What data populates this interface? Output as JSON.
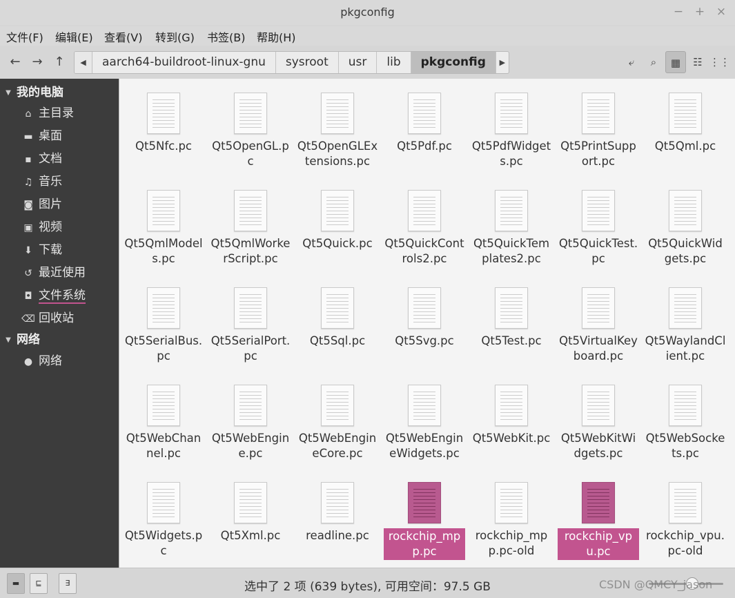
{
  "window": {
    "title": "pkgconfig",
    "minimize": "−",
    "maximize": "+",
    "close": "×"
  },
  "menu": [
    "文件(F)",
    "编辑(E)",
    "查看(V)",
    "转到(G)",
    "书签(B)",
    "帮助(H)"
  ],
  "toolbar": {
    "back_icon": "←",
    "forward_icon": "→",
    "up_icon": "↑",
    "crumb_prev": "◀",
    "crumb_next": "▶",
    "breadcrumbs": [
      "aarch64-buildroot-linux-gnu",
      "sysroot",
      "usr",
      "lib",
      "pkgconfig"
    ],
    "active_crumb": "pkgconfig",
    "location_icon": "⤶",
    "search_icon": "⌕",
    "icon_view_icon": "▦",
    "list_view_icon": "☷",
    "compact_view_icon": "⋮⋮"
  },
  "sidebar": {
    "computer_header": "我的电脑",
    "network_header": "网络",
    "items": [
      {
        "icon": "⌂",
        "label": "主目录"
      },
      {
        "icon": "▬",
        "label": "桌面"
      },
      {
        "icon": "▪",
        "label": "文档"
      },
      {
        "icon": "♫",
        "label": "音乐"
      },
      {
        "icon": "◙",
        "label": "图片"
      },
      {
        "icon": "▣",
        "label": "视频"
      },
      {
        "icon": "⬇",
        "label": "下载"
      },
      {
        "icon": "↺",
        "label": "最近使用"
      },
      {
        "icon": "◘",
        "label": "文件系统"
      },
      {
        "icon": "⌫",
        "label": "回收站"
      }
    ],
    "network_items": [
      {
        "icon": "●",
        "label": "网络"
      }
    ]
  },
  "files": [
    {
      "name": "Qt5Nfc.pc"
    },
    {
      "name": "Qt5OpenGL.pc"
    },
    {
      "name": "Qt5OpenGLExtensions.pc"
    },
    {
      "name": "Qt5Pdf.pc"
    },
    {
      "name": "Qt5PdfWidgets.pc"
    },
    {
      "name": "Qt5PrintSupport.pc"
    },
    {
      "name": "Qt5Qml.pc"
    },
    {
      "name": "Qt5QmlModels.pc"
    },
    {
      "name": "Qt5QmlWorkerScript.pc"
    },
    {
      "name": "Qt5Quick.pc"
    },
    {
      "name": "Qt5QuickControls2.pc"
    },
    {
      "name": "Qt5QuickTemplates2.pc"
    },
    {
      "name": "Qt5QuickTest.pc"
    },
    {
      "name": "Qt5QuickWidgets.pc"
    },
    {
      "name": "Qt5SerialBus.pc"
    },
    {
      "name": "Qt5SerialPort.pc"
    },
    {
      "name": "Qt5Sql.pc"
    },
    {
      "name": "Qt5Svg.pc"
    },
    {
      "name": "Qt5Test.pc"
    },
    {
      "name": "Qt5VirtualKeyboard.pc"
    },
    {
      "name": "Qt5WaylandClient.pc"
    },
    {
      "name": "Qt5WebChannel.pc"
    },
    {
      "name": "Qt5WebEngine.pc"
    },
    {
      "name": "Qt5WebEngineCore.pc"
    },
    {
      "name": "Qt5WebEngineWidgets.pc"
    },
    {
      "name": "Qt5WebKit.pc"
    },
    {
      "name": "Qt5WebKitWidgets.pc"
    },
    {
      "name": "Qt5WebSockets.pc"
    },
    {
      "name": "Qt5Widgets.pc"
    },
    {
      "name": "Qt5Xml.pc"
    },
    {
      "name": "readline.pc"
    },
    {
      "name": "rockchip_mpp.pc",
      "selected": true
    },
    {
      "name": "rockchip_mpp.pc-old"
    },
    {
      "name": "rockchip_vpu.pc",
      "selected": true
    },
    {
      "name": "rockchip_vpu.pc-old"
    }
  ],
  "status": {
    "text": "选中了 2 项 (639 bytes), 可用空间：97.5 GB",
    "places_icon": "▬",
    "tree_icon": "⊑",
    "toggle_icon": "∃"
  },
  "watermark": "CSDN @QMCY_jason",
  "colors": {
    "selection": "#c2548f",
    "sidebar_bg": "#3c3c3c",
    "content_bg": "#f4f4f4"
  }
}
